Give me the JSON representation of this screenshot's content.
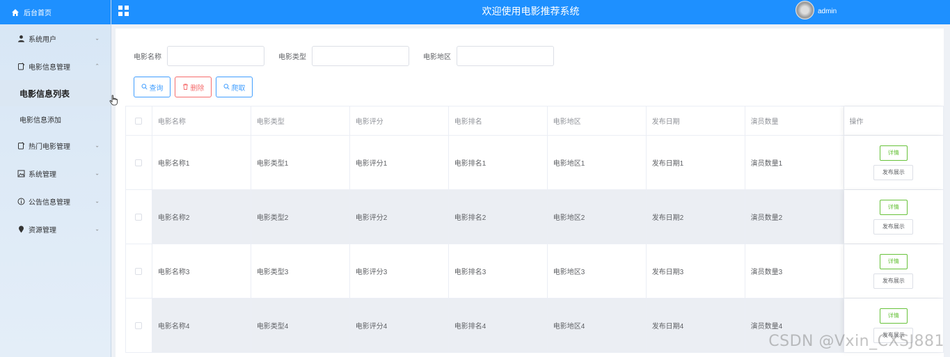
{
  "sidebar": {
    "home_label": "后台首页",
    "menus": [
      {
        "label": "系统用户",
        "icon": "user-icon"
      },
      {
        "label": "电影信息管理",
        "icon": "document-icon"
      },
      {
        "label": "热门电影管理",
        "icon": "document-icon"
      },
      {
        "label": "系统管理",
        "icon": "image-icon"
      },
      {
        "label": "公告信息管理",
        "icon": "info-icon"
      },
      {
        "label": "资源管理",
        "icon": "location-icon"
      }
    ],
    "submenu": [
      {
        "label": "电影信息列表",
        "active": true
      },
      {
        "label": "电影信息添加",
        "active": false
      }
    ]
  },
  "header": {
    "title": "欢迎使用电影推荐系统",
    "username": "admin"
  },
  "search": {
    "fields": [
      {
        "label": "电影名称",
        "value": ""
      },
      {
        "label": "电影类型",
        "value": ""
      },
      {
        "label": "电影地区",
        "value": ""
      }
    ],
    "query_label": "查询",
    "delete_label": "删除",
    "crawl_label": "爬取"
  },
  "table": {
    "columns": [
      "电影名称",
      "电影类型",
      "电影评分",
      "电影排名",
      "电影地区",
      "发布日期",
      "演员数量"
    ],
    "op_header": "操作",
    "detail_label": "详情",
    "publish_label": "发布展示",
    "rows": [
      [
        "电影名称1",
        "电影类型1",
        "电影评分1",
        "电影排名1",
        "电影地区1",
        "发布日期1",
        "演员数量1"
      ],
      [
        "电影名称2",
        "电影类型2",
        "电影评分2",
        "电影排名2",
        "电影地区2",
        "发布日期2",
        "演员数量2"
      ],
      [
        "电影名称3",
        "电影类型3",
        "电影评分3",
        "电影排名3",
        "电影地区3",
        "发布日期3",
        "演员数量3"
      ],
      [
        "电影名称4",
        "电影类型4",
        "电影评分4",
        "电影排名4",
        "电影地区4",
        "发布日期4",
        "演员数量4"
      ]
    ]
  },
  "colors": {
    "primary": "#1e90ff",
    "button_blue": "#409eff",
    "button_red": "#f56c6c",
    "button_green": "#67c23a"
  },
  "watermark": "CSDN @Vxin_CXSJ881"
}
